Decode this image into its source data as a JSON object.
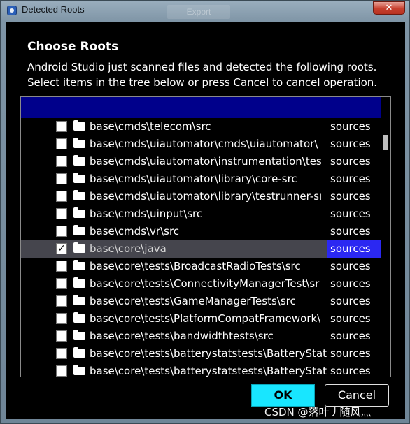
{
  "window": {
    "title": "Detected Roots",
    "background_tab": "Export",
    "close_label": "✕"
  },
  "dialog": {
    "heading": "Choose Roots",
    "description_line1": "Android Studio just scanned files and detected the following roots.",
    "description_line2": "Select items in the tree below or press Cancel to cancel operation."
  },
  "tree": {
    "rows": [
      {
        "path": "base\\cmds\\telecom\\src",
        "type": "sources",
        "checked": false
      },
      {
        "path": "base\\cmds\\uiautomator\\cmds\\uiautomator\\",
        "type": "sources",
        "checked": false
      },
      {
        "path": "base\\cmds\\uiautomator\\instrumentation\\tes",
        "type": "sources",
        "checked": false
      },
      {
        "path": "base\\cmds\\uiautomator\\library\\core-src",
        "type": "sources",
        "checked": false
      },
      {
        "path": "base\\cmds\\uiautomator\\library\\testrunner-sı",
        "type": "sources",
        "checked": false
      },
      {
        "path": "base\\cmds\\uinput\\src",
        "type": "sources",
        "checked": false
      },
      {
        "path": "base\\cmds\\vr\\src",
        "type": "sources",
        "checked": false
      },
      {
        "path": "base\\core\\java",
        "type": "sources",
        "checked": true,
        "selected": true
      },
      {
        "path": "base\\core\\tests\\BroadcastRadioTests\\src",
        "type": "sources",
        "checked": false
      },
      {
        "path": "base\\core\\tests\\ConnectivityManagerTest\\sr",
        "type": "sources",
        "checked": false
      },
      {
        "path": "base\\core\\tests\\GameManagerTests\\src",
        "type": "sources",
        "checked": false
      },
      {
        "path": "base\\core\\tests\\PlatformCompatFramework\\",
        "type": "sources",
        "checked": false
      },
      {
        "path": "base\\core\\tests\\bandwidthtests\\src",
        "type": "sources",
        "checked": false
      },
      {
        "path": "base\\core\\tests\\batterystatstests\\BatteryStat",
        "type": "sources",
        "checked": false
      },
      {
        "path": "base\\core\\tests\\batterystatstests\\BatteryStat",
        "type": "sources",
        "checked": false
      }
    ]
  },
  "buttons": {
    "ok": "OK",
    "cancel": "Cancel"
  },
  "watermark": "CSDN @落叶丿随风灬",
  "colors": {
    "header": "#00008b",
    "selected_row": "#45454d",
    "selected_type": "#2b28f2",
    "ok_button": "#18e6ff"
  }
}
